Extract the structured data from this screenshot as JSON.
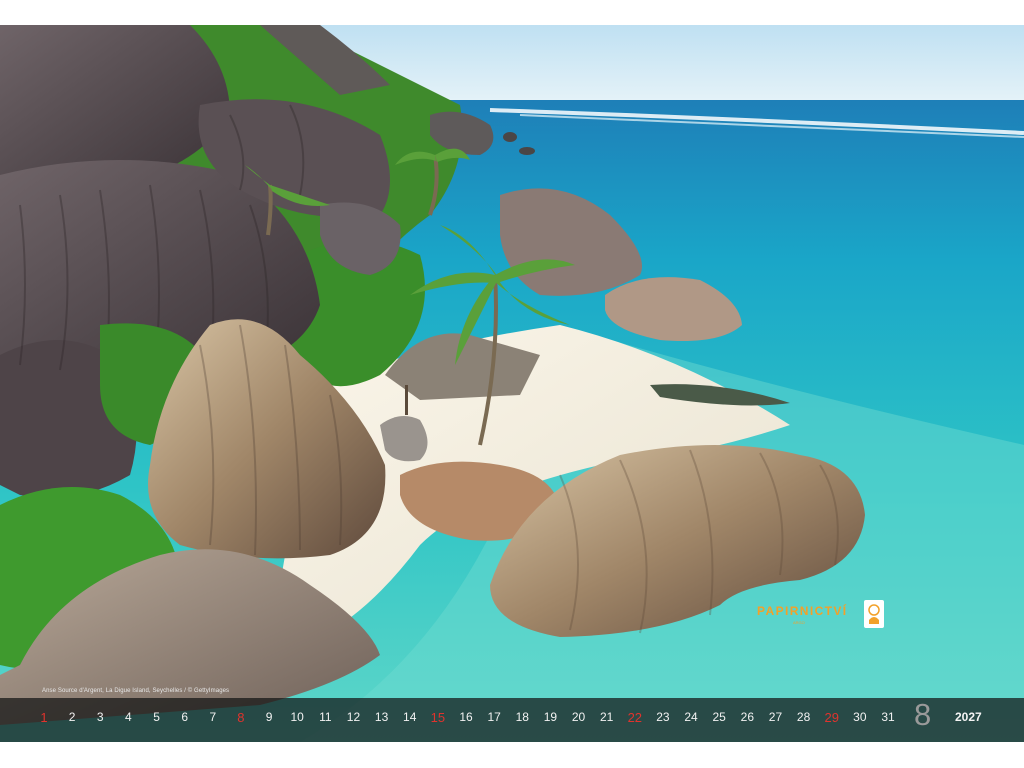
{
  "photo": {
    "caption": "Anse Source d'Argent, La Digue Island, Seychelles / © GettyImages",
    "watermark": "PAPIRNICTVÍ",
    "watermark_sub": "ARGO"
  },
  "calendar": {
    "month": "8",
    "year": "2027",
    "days": [
      {
        "label": "1",
        "holiday": true
      },
      {
        "label": "2",
        "holiday": false
      },
      {
        "label": "3",
        "holiday": false
      },
      {
        "label": "4",
        "holiday": false
      },
      {
        "label": "5",
        "holiday": false
      },
      {
        "label": "6",
        "holiday": false
      },
      {
        "label": "7",
        "holiday": false
      },
      {
        "label": "8",
        "holiday": true
      },
      {
        "label": "9",
        "holiday": false
      },
      {
        "label": "10",
        "holiday": false
      },
      {
        "label": "11",
        "holiday": false
      },
      {
        "label": "12",
        "holiday": false
      },
      {
        "label": "13",
        "holiday": false
      },
      {
        "label": "14",
        "holiday": false
      },
      {
        "label": "15",
        "holiday": true
      },
      {
        "label": "16",
        "holiday": false
      },
      {
        "label": "17",
        "holiday": false
      },
      {
        "label": "18",
        "holiday": false
      },
      {
        "label": "19",
        "holiday": false
      },
      {
        "label": "20",
        "holiday": false
      },
      {
        "label": "21",
        "holiday": false
      },
      {
        "label": "22",
        "holiday": true
      },
      {
        "label": "23",
        "holiday": false
      },
      {
        "label": "24",
        "holiday": false
      },
      {
        "label": "25",
        "holiday": false
      },
      {
        "label": "26",
        "holiday": false
      },
      {
        "label": "27",
        "holiday": false
      },
      {
        "label": "28",
        "holiday": false
      },
      {
        "label": "29",
        "holiday": true
      },
      {
        "label": "30",
        "holiday": false
      },
      {
        "label": "31",
        "holiday": false
      }
    ],
    "holiday_color": "#e0332d"
  }
}
